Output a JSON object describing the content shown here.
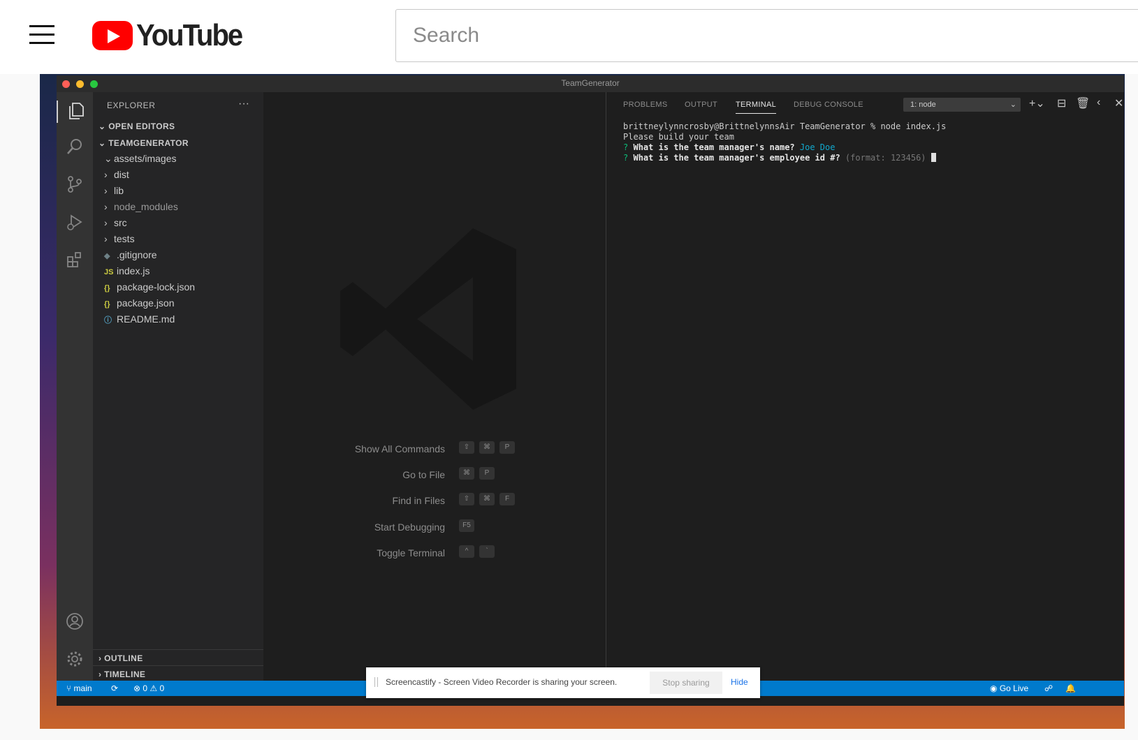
{
  "youtube": {
    "logo_text": "YouTube",
    "search_placeholder": "Search"
  },
  "vscode": {
    "window_title": "TeamGenerator",
    "sidebar": {
      "header": "EXPLORER",
      "more": "···",
      "open_editors": "OPEN EDITORS",
      "project": "TEAMGENERATOR",
      "tree": [
        {
          "chevron": "⌄",
          "icon": "",
          "label": "assets/images"
        },
        {
          "chevron": "›",
          "icon": "",
          "label": "dist"
        },
        {
          "chevron": "›",
          "icon": "",
          "label": "lib"
        },
        {
          "chevron": "›",
          "icon": "",
          "label": "node_modules"
        },
        {
          "chevron": "›",
          "icon": "",
          "label": "src"
        },
        {
          "chevron": "›",
          "icon": "",
          "label": "tests"
        },
        {
          "chevron": "",
          "icon": "◆",
          "label": ".gitignore"
        },
        {
          "chevron": "",
          "icon": "JS",
          "label": "index.js"
        },
        {
          "chevron": "",
          "icon": "{}",
          "label": "package-lock.json"
        },
        {
          "chevron": "",
          "icon": "{}",
          "label": "package.json"
        },
        {
          "chevron": "",
          "icon": "ⓘ",
          "label": "README.md"
        }
      ],
      "outline": "OUTLINE",
      "timeline": "TIMELINE"
    },
    "shortcuts": [
      {
        "label": "Show All Commands",
        "keys": [
          "⇧",
          "⌘",
          "P"
        ]
      },
      {
        "label": "Go to File",
        "keys": [
          "⌘",
          "P"
        ]
      },
      {
        "label": "Find in Files",
        "keys": [
          "⇧",
          "⌘",
          "F"
        ]
      },
      {
        "label": "Start Debugging",
        "keys": [
          "F5"
        ]
      },
      {
        "label": "Toggle Terminal",
        "keys": [
          "^",
          "`"
        ]
      }
    ],
    "panel": {
      "tabs": [
        "PROBLEMS",
        "OUTPUT",
        "TERMINAL",
        "DEBUG CONSOLE"
      ],
      "active_tab": "TERMINAL",
      "terminal_select": "1: node",
      "terminal": {
        "prompt_line": "brittneylynncrosby@BrittnelynnsAir TeamGenerator % node index.js",
        "line2": "Please build your team",
        "q1_mark": "?",
        "q1": "What is the team manager's name?",
        "a1": "Joe Doe",
        "q2_mark": "?",
        "q2": "What is the team manager's employee id #?",
        "hint": "(format: 123456)"
      }
    },
    "statusbar": {
      "branch": "main",
      "sync": "⟳",
      "errors": "0",
      "warnings": "0",
      "go_live": "Go Live"
    },
    "notification": {
      "text": "Screencastify - Screen Video Recorder is sharing your screen.",
      "stop": "Stop sharing",
      "hide": "Hide"
    }
  }
}
